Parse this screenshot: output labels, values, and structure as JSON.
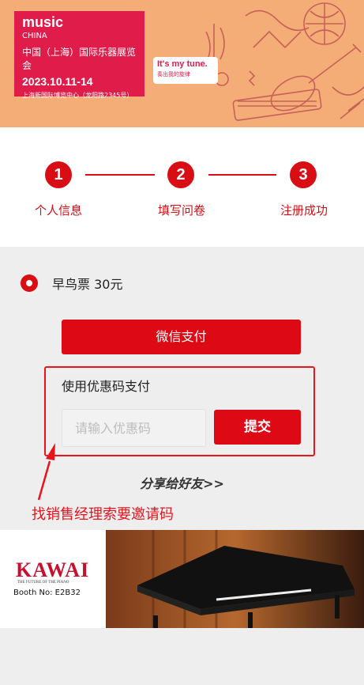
{
  "banner": {
    "brand": "music",
    "brand_sub": "CHINA",
    "title": "中国（上海）国际乐器展览会",
    "date": "2023.10.11-14",
    "venue": "上海新国际博览中心（龙阳路2345号）",
    "slogan_en": "It's my tune.",
    "slogan_zh": "奏出我的旋律"
  },
  "steps": [
    {
      "number": "1",
      "label": "个人信息"
    },
    {
      "number": "2",
      "label": "填写问卷"
    },
    {
      "number": "3",
      "label": "注册成功"
    }
  ],
  "ticket": {
    "label": "早鸟票 30元",
    "selected": true
  },
  "payment": {
    "wechat_label": "微信支付",
    "coupon_title": "使用优惠码支付",
    "coupon_placeholder": "请输入优惠码",
    "coupon_value": "",
    "submit_label": "提交"
  },
  "share_label": "分享给好友>>",
  "annotation": "找销售经理索要邀请码",
  "ad": {
    "brand": "KAWAI",
    "tagline": "THE FUTURE OF THE PIANO",
    "booth": "Booth  No: E2B32"
  },
  "colors": {
    "accent": "#d90d14",
    "banner_bg": "#f4ad77",
    "logo_bg": "#e01c4a"
  }
}
